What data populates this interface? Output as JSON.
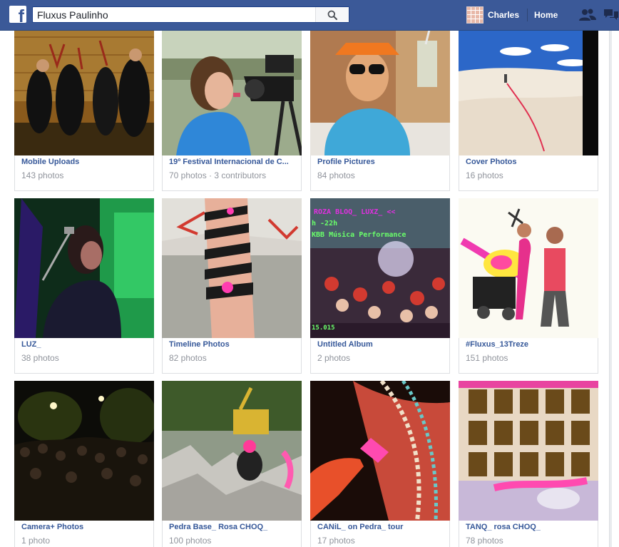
{
  "search": {
    "value": "Fluxus Paulinho"
  },
  "header": {
    "logo": "f",
    "profile_name": "Charles",
    "home_label": "Home"
  },
  "colors": {
    "facebook_blue": "#3b5998",
    "link_blue": "#365899",
    "meta_gray": "#90949c"
  },
  "albums": [
    {
      "title": "Mobile Uploads",
      "count": "143 photos"
    },
    {
      "title": "19º Festival Internacional de C...",
      "count": "70 photos · 3 contributors"
    },
    {
      "title": "Profile Pictures",
      "count": "84 photos"
    },
    {
      "title": "Cover Photos",
      "count": "16 photos"
    },
    {
      "title": "LUZ_",
      "count": "38 photos"
    },
    {
      "title": "Timeline Photos",
      "count": "82 photos"
    },
    {
      "title": "Untitled Album",
      "count": "2 photos"
    },
    {
      "title": "#Fluxus_13Treze",
      "count": "151 photos"
    },
    {
      "title": "Camera+ Photos",
      "count": "1 photo"
    },
    {
      "title": "Pedra Base_ Rosa CHOQ_",
      "count": "100 photos"
    },
    {
      "title": "CANiL_ on Pedra_ tour",
      "count": "17 photos"
    },
    {
      "title": "TANQ_ rosa CHOQ_",
      "count": "78 photos"
    }
  ],
  "cover_captions": {
    "untitled_line1": "ROZA BLOQ_ LUXZ_ <<",
    "untitled_line2": "h -22h",
    "untitled_line3": "KBB Música Performance",
    "untitled_line4": "15.015"
  },
  "icons": [
    "facebook-logo-icon",
    "search-icon",
    "friend-requests-icon",
    "messages-icon"
  ]
}
